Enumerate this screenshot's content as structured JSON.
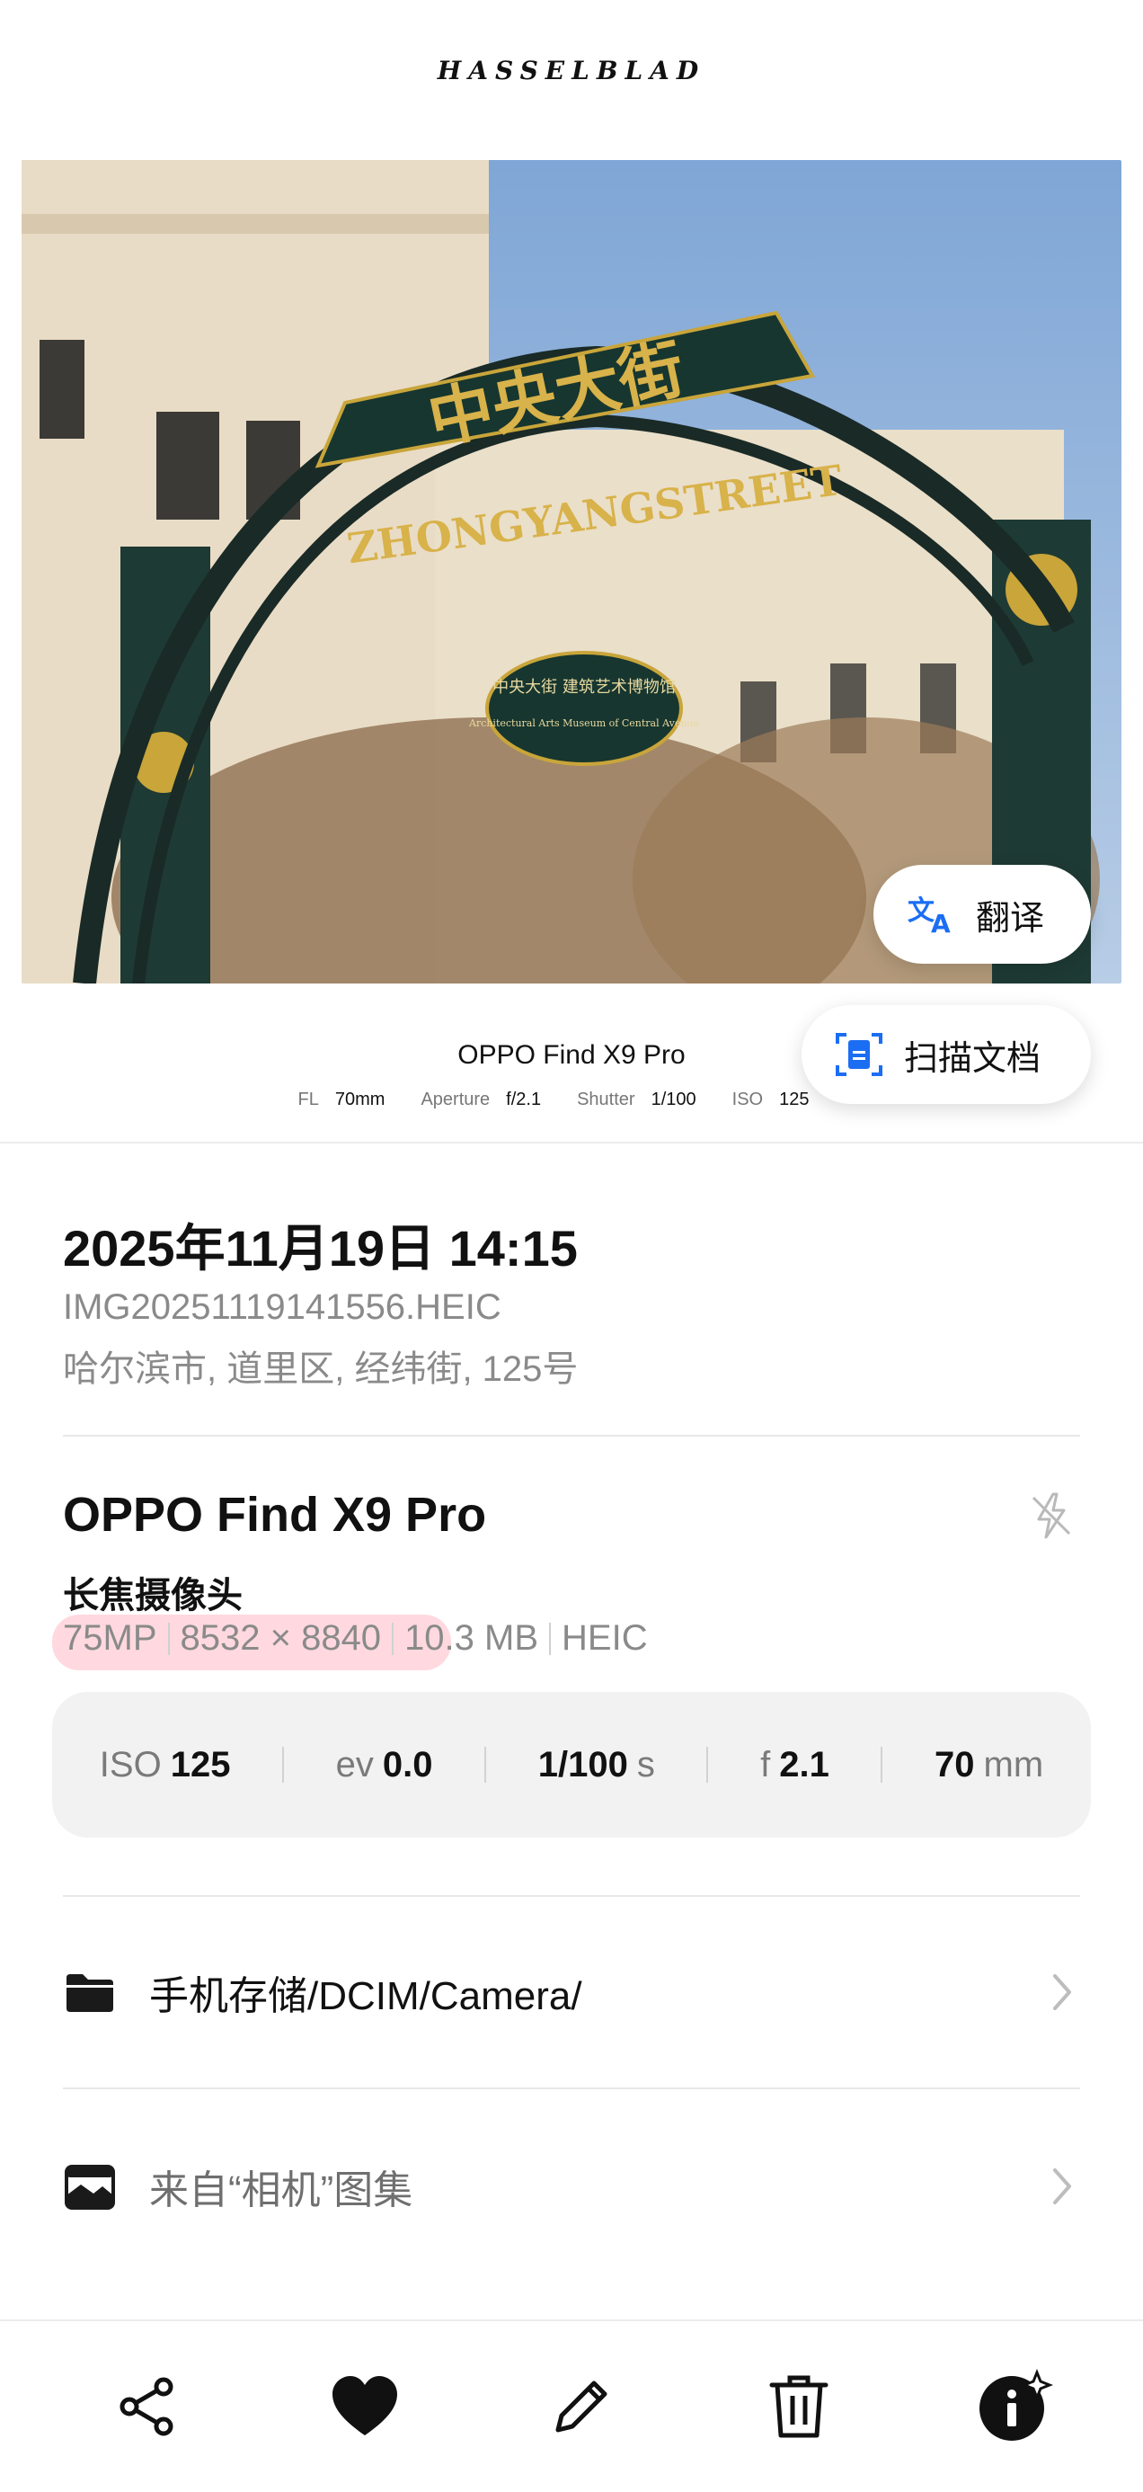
{
  "brand": "HASSELBLAD",
  "photo": {
    "sign_cn": "中央大街",
    "sign_en": "ZHONGYANGSTREET",
    "plaque_cn": "中央大街 建筑艺术博物馆",
    "plaque_en": "Architectural Arts Museum of Central Avenue"
  },
  "overlay": {
    "translate_label": "翻译",
    "scan_label": "扫描文档"
  },
  "watermark": {
    "model": "OPPO Find X9 Pro",
    "fl_label": "FL",
    "fl_value": "70mm",
    "aperture_label": "Aperture",
    "aperture_value": "f/2.1",
    "shutter_label": "Shutter",
    "shutter_value": "1/100",
    "iso_label": "ISO",
    "iso_value": "125"
  },
  "info": {
    "datetime": "2025年11月19日 14:15",
    "filename": "IMG20251119141556.HEIC",
    "location": "哈尔滨市, 道里区, 经纬街, 125号"
  },
  "device": {
    "name": "OPPO Find X9 Pro",
    "lens": "长焦摄像头",
    "megapixels": "75MP",
    "resolution": "8532 × 8840",
    "size": "10.3 MB",
    "format": "HEIC",
    "flash_icon": "flash-off-icon"
  },
  "exif": {
    "iso_label": "ISO",
    "iso_value": "125",
    "ev_label": "ev",
    "ev_value": "0.0",
    "shutter_value": "1/100",
    "shutter_unit": "s",
    "aperture_label": "f",
    "aperture_value": "2.1",
    "focal_value": "70",
    "focal_unit": "mm"
  },
  "storage": {
    "path": "手机存储/DCIM/Camera/",
    "album": "来自“相机”图集"
  },
  "toolbar": {
    "icons": [
      "share-icon",
      "favorite-heart-icon",
      "edit-pencil-icon",
      "delete-trash-icon",
      "info-ai-icon"
    ]
  },
  "colors": {
    "accent_blue": "#1b6ef3",
    "highlight_pink": "#ff788c"
  }
}
